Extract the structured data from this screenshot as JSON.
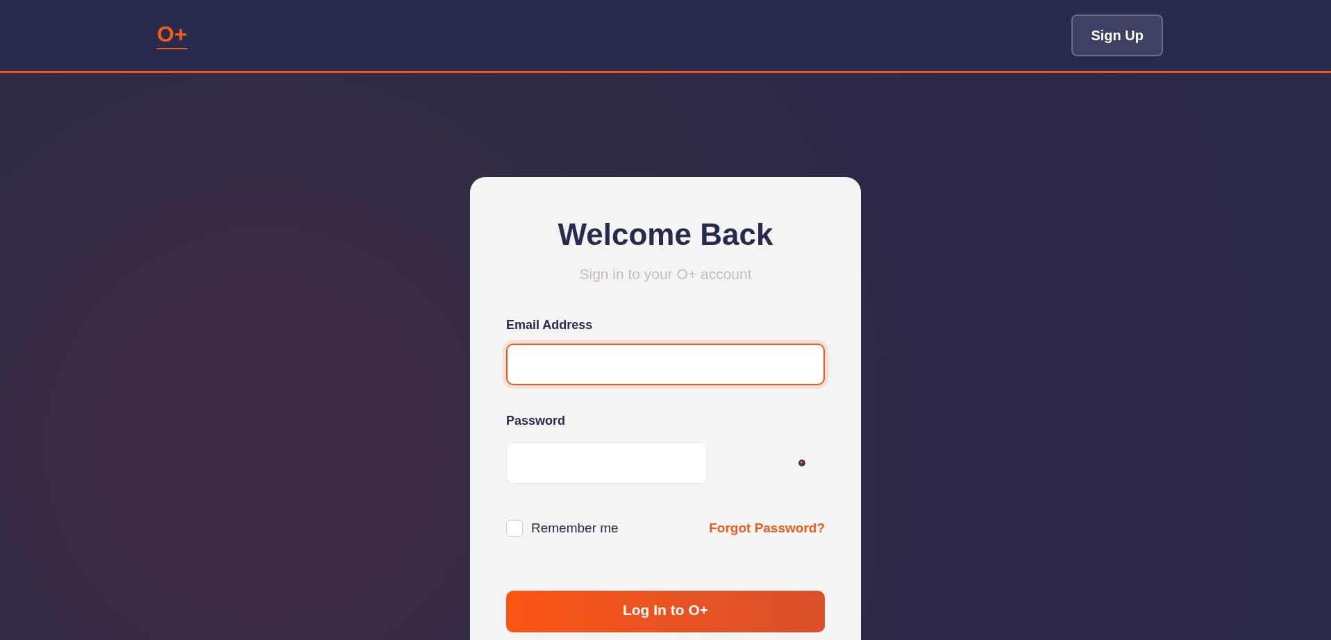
{
  "header": {
    "logo": "O+",
    "signup_button": "Sign Up"
  },
  "login_card": {
    "title": "Welcome Back",
    "subtitle": "Sign in to your O+ account",
    "fields": [
      {
        "kind": "email",
        "label": "Email Address",
        "focused": true
      },
      {
        "kind": "password",
        "label": "Password",
        "focused": false
      }
    ],
    "remember_me": {
      "label": "Remember me",
      "checked": false
    },
    "forgot_link": "Forgot Password?",
    "submit_button": "Log In to O+"
  }
}
